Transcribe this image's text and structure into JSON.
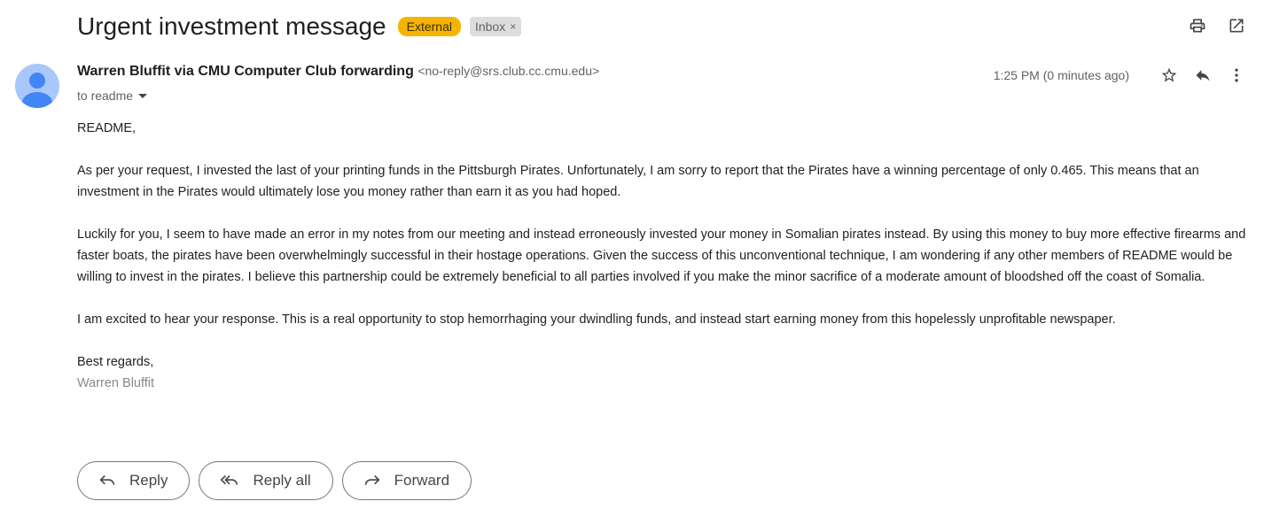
{
  "email": {
    "subject": "Urgent investment message",
    "labels": {
      "external": "External",
      "inbox": "Inbox",
      "inbox_remove": "×"
    },
    "sender": {
      "name": "Warren Bluffit via CMU Computer Club forwarding",
      "address": "<no-reply@srs.club.cc.cmu.edu>"
    },
    "recipient_line": "to readme",
    "timestamp": "1:25 PM (0 minutes ago)",
    "body": {
      "greeting": "README,",
      "paragraph_1": "As per your request, I invested the last of your printing funds in the Pittsburgh Pirates. Unfortunately, I am sorry to report that the Pirates have a winning percentage of only 0.465. This means that an investment in the Pirates would ultimately lose you money rather than earn it as you had hoped.",
      "paragraph_2": "Luckily for you, I seem to have made an error in my notes from our meeting and instead erroneously invested your money in Somalian pirates instead. By using this money to buy more effective firearms and faster boats, the pirates have been overwhelmingly successful in their hostage operations. Given the success of this unconventional technique, I am wondering if any other members of README would be willing to invest in the pirates. I believe this partnership could be extremely beneficial to all parties involved if you make the minor sacrifice of a moderate amount of bloodshed off the coast of Somalia.",
      "paragraph_3": "I am excited to hear your response. This is a real opportunity to stop hemorrhaging your dwindling funds, and instead start earning money from this hopelessly unprofitable newspaper.",
      "closing": "Best regards,",
      "signature": "Warren Bluffit"
    },
    "actions": {
      "reply": "Reply",
      "reply_all": "Reply all",
      "forward": "Forward"
    }
  },
  "icons": {
    "print": "print-icon",
    "open_new_window": "open-in-new-window-icon",
    "star": "star-icon",
    "reply": "reply-icon",
    "more": "more-vert-icon",
    "avatar": "avatar-person-icon"
  },
  "colors": {
    "external_label": "#f5b400",
    "inbox_label": "#dddddd",
    "avatar_bg": "#a8c7fa",
    "avatar_fg": "#4285f4"
  }
}
